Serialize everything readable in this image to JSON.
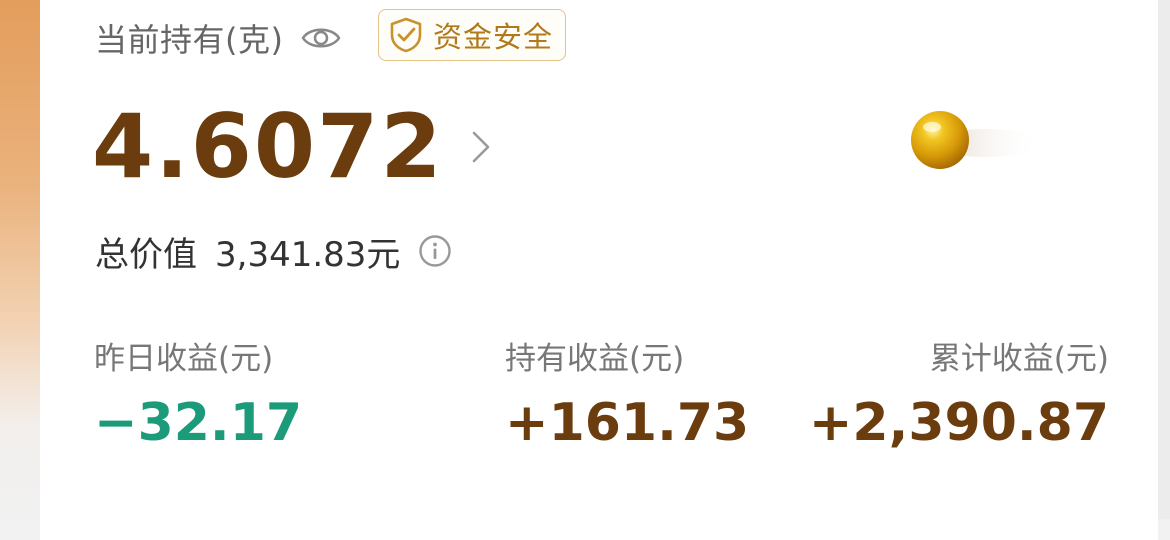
{
  "header": {
    "title": "当前持有(克)",
    "badge_text": "资金安全"
  },
  "holdings": {
    "grams": "4.6072"
  },
  "total": {
    "label": "总价值",
    "value": "3,341.83元"
  },
  "stats": [
    {
      "label": "昨日收益(元)",
      "value": "−32.17"
    },
    {
      "label": "持有收益(元)",
      "value": "+161.73"
    },
    {
      "label": "累计收益(元)",
      "value": "+2,390.87"
    }
  ],
  "colors": {
    "brown": "#6b3d0e",
    "green": "#1b9b7a",
    "gold": "#b07a1c",
    "gray_text": "#666666"
  },
  "icons": [
    "eye-icon",
    "shield-check-icon",
    "chevron-right-icon",
    "gold-ball-icon",
    "info-icon"
  ]
}
